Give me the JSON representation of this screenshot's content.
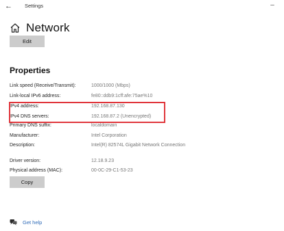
{
  "window": {
    "title": "Settings",
    "back_symbol": "←",
    "minimize_symbol": "–"
  },
  "header": {
    "icon": "home-icon",
    "title": "Network"
  },
  "buttons": {
    "edit_label": "Edit",
    "copy_label": "Copy"
  },
  "properties": {
    "section_title": "Properties",
    "rows": [
      {
        "label": "Link speed (Receive/Transmit):",
        "value": "1000/1000 (Mbps)"
      },
      {
        "label": "Link-local IPv6 address:",
        "value": "fe80::ddb9:1cff:afe:75ae%10"
      },
      {
        "label": "IPv4 address:",
        "value": "192.168.87.130"
      },
      {
        "label": "IPv4 DNS servers:",
        "value": "192.168.87.2 (Unencrypted)"
      },
      {
        "label": "Primary DNS suffix:",
        "value": "localdomain"
      },
      {
        "label": "Manufacturer:",
        "value": "Intel Corporation"
      },
      {
        "label": "Description:",
        "value": "Intel(R) 82574L Gigabit Network Connection"
      },
      {
        "label": "Driver version:",
        "value": "12.18.9.23"
      },
      {
        "label": "Physical address (MAC):",
        "value": "00-0C-29-C1-53-23"
      }
    ],
    "highlight_color": "#e0343a"
  },
  "footer": {
    "help_icon": "help-icon",
    "help_label": "Get help",
    "link_color": "#2f6bb8"
  }
}
